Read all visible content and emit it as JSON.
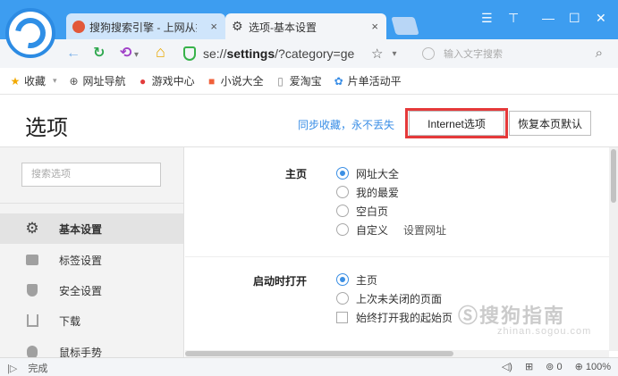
{
  "tabs": [
    {
      "label": "搜狗搜索引擎 - 上网从搜",
      "icon": "sogou-icon"
    },
    {
      "label": "选项-基本设置",
      "icon": "gear-icon"
    }
  ],
  "controls": {
    "close": "×",
    "menu": "☰",
    "minimize": "—",
    "maximize": "☐",
    "window_close": "✕"
  },
  "nav": {
    "back": "←",
    "refresh": "↻",
    "undo": "⟲",
    "home": "⌂",
    "address_prefix": "se://",
    "address_bold": "settings",
    "address_suffix": "/?category=ge",
    "star": "☆",
    "dropdown": "▾"
  },
  "search": {
    "placeholder": "输入文字搜索",
    "mag": "⌕"
  },
  "bookmarks": [
    {
      "label": "收藏",
      "icon": "star-icon",
      "glyph": "★",
      "color": "#f2a900"
    },
    {
      "label": "网址导航",
      "icon": "globe-icon",
      "glyph": "⊕",
      "color": "#555555"
    },
    {
      "label": "游戏中心",
      "icon": "game-icon",
      "glyph": "●",
      "color": "#e23b3b"
    },
    {
      "label": "小说大全",
      "icon": "book-icon",
      "glyph": "■",
      "color": "#f0603a"
    },
    {
      "label": "爱淘宝",
      "icon": "page-icon",
      "glyph": "▯",
      "color": "#888888"
    },
    {
      "label": "片单活动平",
      "icon": "paw-icon",
      "glyph": "✿",
      "color": "#3a8ee6"
    }
  ],
  "header": {
    "title": "选项",
    "sync_link": "同步收藏，永不丢失",
    "internet_options": "Internet选项",
    "reset_defaults": "恢复本页默认"
  },
  "sidebar": {
    "search_placeholder": "搜索选项",
    "items": [
      {
        "label": "基本设置",
        "icon": "gear-icon",
        "active": true
      },
      {
        "label": "标签设置",
        "icon": "tab-icon",
        "active": false
      },
      {
        "label": "安全设置",
        "icon": "shield-icon",
        "active": false
      },
      {
        "label": "下载",
        "icon": "download-icon",
        "active": false
      },
      {
        "label": "鼠标手势",
        "icon": "mouse-icon",
        "active": false
      }
    ]
  },
  "homepage": {
    "label": "主页",
    "options": [
      {
        "label": "网址大全",
        "selected": true
      },
      {
        "label": "我的最爱",
        "selected": false
      },
      {
        "label": "空白页",
        "selected": false
      },
      {
        "label": "自定义",
        "selected": false
      }
    ],
    "custom_link": "设置网址"
  },
  "startup": {
    "label": "启动时打开",
    "options": [
      {
        "label": "主页",
        "selected": true
      },
      {
        "label": "上次未关闭的页面",
        "selected": false
      }
    ],
    "checkbox": {
      "label": "始终打开我的起始页",
      "checked": false
    }
  },
  "watermark": {
    "text": "Ⓢ搜狗指南",
    "url": "zhinan.sogou.com"
  },
  "status": {
    "text": "完成",
    "count": "0",
    "zoom": "100%"
  }
}
